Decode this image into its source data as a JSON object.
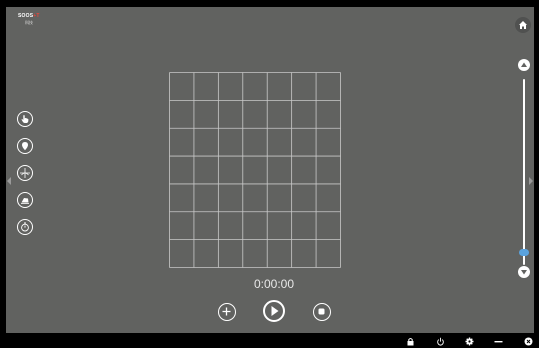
{
  "app": {
    "logo_line1": "SOOS",
    "logo_line1_accent": "+T",
    "logo_line2": "科技"
  },
  "toolbar": {
    "items": [
      {
        "icon": "hand-pointer-icon"
      },
      {
        "icon": "location-pin-icon"
      },
      {
        "icon": "crosshair-icon"
      },
      {
        "icon": "eraser-icon"
      },
      {
        "icon": "stopwatch-icon"
      }
    ]
  },
  "grid": {
    "columns": 7,
    "rows": 7
  },
  "timer": {
    "display": "0:00:00"
  },
  "controls": {
    "add_icon": "plus-icon",
    "play_icon": "play-icon",
    "stop_icon": "stop-icon"
  },
  "zoom": {
    "level": 0.05,
    "up_icon": "chevron-up-icon",
    "down_icon": "chevron-down-icon"
  },
  "taskbar": {
    "icons": [
      "lock-icon",
      "power-icon",
      "gear-icon",
      "minimize-icon",
      "close-icon"
    ]
  },
  "colors": {
    "background": "#616260",
    "grid_line": "#c9c9c9",
    "accent": "#5ba3dd"
  }
}
